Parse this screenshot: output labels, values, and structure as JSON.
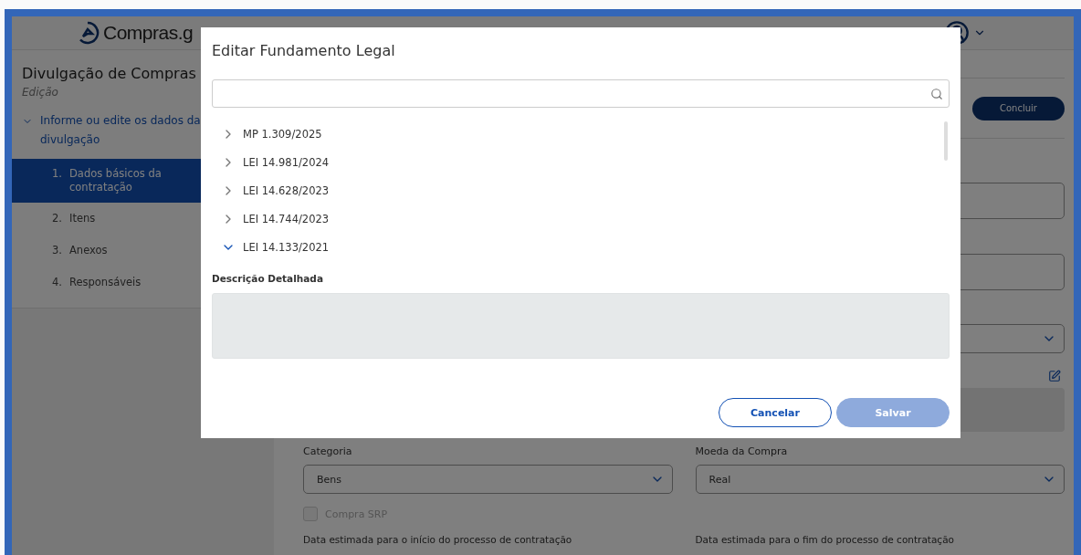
{
  "header": {
    "logo_text": "Compras.g"
  },
  "sidebar": {
    "title": "Divulgação de Compras",
    "subtitle": "Edição",
    "section": {
      "label": "Informe ou edite os dados da divulgação",
      "expanded": true,
      "items": [
        {
          "number": "1.",
          "label": "Dados básicos da contratação",
          "selected": true
        },
        {
          "number": "2.",
          "label": "Itens",
          "selected": false
        },
        {
          "number": "3.",
          "label": "Anexos",
          "selected": false
        },
        {
          "number": "4.",
          "label": "Responsáveis",
          "selected": false
        }
      ]
    }
  },
  "toolbar": {
    "button": "Concluir"
  },
  "form": {
    "selects": [
      {
        "label": "Categoria",
        "value": "Bens"
      },
      {
        "label": "Moeda da Compra",
        "value": "Real"
      }
    ],
    "checkbox": {
      "label": "Compra SRP",
      "checked": false,
      "disabled": true
    },
    "date_labels": [
      "Data estimada para o início do processo de contratação",
      "Data estimada para o fim do processo de contratação"
    ]
  },
  "dialog": {
    "title": "Editar Fundamento Legal",
    "tree": [
      {
        "label": "MP 1.309/2025",
        "expanded": false
      },
      {
        "label": "LEI 14.981/2024",
        "expanded": false
      },
      {
        "label": "LEI 14.628/2023",
        "expanded": false
      },
      {
        "label": "LEI 14.744/2023",
        "expanded": false
      },
      {
        "label": "LEI 14.133/2021",
        "expanded": true
      }
    ],
    "description_label": "Descrição Detalhada",
    "buttons": [
      {
        "label": "Cancelar",
        "kind": "secondary",
        "disabled": false
      },
      {
        "label": "Salvar",
        "kind": "primary",
        "disabled": true
      }
    ]
  }
}
